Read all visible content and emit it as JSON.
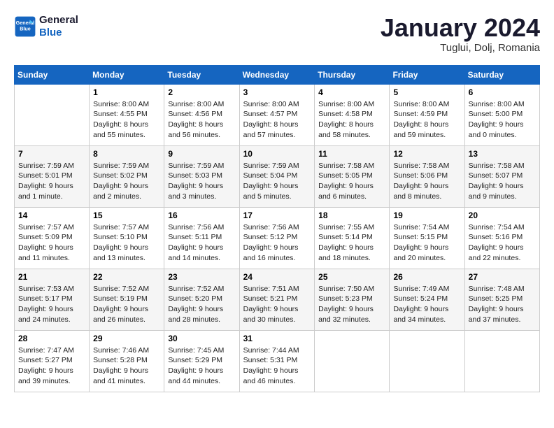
{
  "header": {
    "logo_line1": "General",
    "logo_line2": "Blue",
    "month": "January 2024",
    "location": "Tuglui, Dolj, Romania"
  },
  "weekdays": [
    "Sunday",
    "Monday",
    "Tuesday",
    "Wednesday",
    "Thursday",
    "Friday",
    "Saturday"
  ],
  "weeks": [
    [
      {
        "day": "",
        "info": ""
      },
      {
        "day": "1",
        "info": "Sunrise: 8:00 AM\nSunset: 4:55 PM\nDaylight: 8 hours\nand 55 minutes."
      },
      {
        "day": "2",
        "info": "Sunrise: 8:00 AM\nSunset: 4:56 PM\nDaylight: 8 hours\nand 56 minutes."
      },
      {
        "day": "3",
        "info": "Sunrise: 8:00 AM\nSunset: 4:57 PM\nDaylight: 8 hours\nand 57 minutes."
      },
      {
        "day": "4",
        "info": "Sunrise: 8:00 AM\nSunset: 4:58 PM\nDaylight: 8 hours\nand 58 minutes."
      },
      {
        "day": "5",
        "info": "Sunrise: 8:00 AM\nSunset: 4:59 PM\nDaylight: 8 hours\nand 59 minutes."
      },
      {
        "day": "6",
        "info": "Sunrise: 8:00 AM\nSunset: 5:00 PM\nDaylight: 9 hours\nand 0 minutes."
      }
    ],
    [
      {
        "day": "7",
        "info": "Sunrise: 7:59 AM\nSunset: 5:01 PM\nDaylight: 9 hours\nand 1 minute."
      },
      {
        "day": "8",
        "info": "Sunrise: 7:59 AM\nSunset: 5:02 PM\nDaylight: 9 hours\nand 2 minutes."
      },
      {
        "day": "9",
        "info": "Sunrise: 7:59 AM\nSunset: 5:03 PM\nDaylight: 9 hours\nand 3 minutes."
      },
      {
        "day": "10",
        "info": "Sunrise: 7:59 AM\nSunset: 5:04 PM\nDaylight: 9 hours\nand 5 minutes."
      },
      {
        "day": "11",
        "info": "Sunrise: 7:58 AM\nSunset: 5:05 PM\nDaylight: 9 hours\nand 6 minutes."
      },
      {
        "day": "12",
        "info": "Sunrise: 7:58 AM\nSunset: 5:06 PM\nDaylight: 9 hours\nand 8 minutes."
      },
      {
        "day": "13",
        "info": "Sunrise: 7:58 AM\nSunset: 5:07 PM\nDaylight: 9 hours\nand 9 minutes."
      }
    ],
    [
      {
        "day": "14",
        "info": "Sunrise: 7:57 AM\nSunset: 5:09 PM\nDaylight: 9 hours\nand 11 minutes."
      },
      {
        "day": "15",
        "info": "Sunrise: 7:57 AM\nSunset: 5:10 PM\nDaylight: 9 hours\nand 13 minutes."
      },
      {
        "day": "16",
        "info": "Sunrise: 7:56 AM\nSunset: 5:11 PM\nDaylight: 9 hours\nand 14 minutes."
      },
      {
        "day": "17",
        "info": "Sunrise: 7:56 AM\nSunset: 5:12 PM\nDaylight: 9 hours\nand 16 minutes."
      },
      {
        "day": "18",
        "info": "Sunrise: 7:55 AM\nSunset: 5:14 PM\nDaylight: 9 hours\nand 18 minutes."
      },
      {
        "day": "19",
        "info": "Sunrise: 7:54 AM\nSunset: 5:15 PM\nDaylight: 9 hours\nand 20 minutes."
      },
      {
        "day": "20",
        "info": "Sunrise: 7:54 AM\nSunset: 5:16 PM\nDaylight: 9 hours\nand 22 minutes."
      }
    ],
    [
      {
        "day": "21",
        "info": "Sunrise: 7:53 AM\nSunset: 5:17 PM\nDaylight: 9 hours\nand 24 minutes."
      },
      {
        "day": "22",
        "info": "Sunrise: 7:52 AM\nSunset: 5:19 PM\nDaylight: 9 hours\nand 26 minutes."
      },
      {
        "day": "23",
        "info": "Sunrise: 7:52 AM\nSunset: 5:20 PM\nDaylight: 9 hours\nand 28 minutes."
      },
      {
        "day": "24",
        "info": "Sunrise: 7:51 AM\nSunset: 5:21 PM\nDaylight: 9 hours\nand 30 minutes."
      },
      {
        "day": "25",
        "info": "Sunrise: 7:50 AM\nSunset: 5:23 PM\nDaylight: 9 hours\nand 32 minutes."
      },
      {
        "day": "26",
        "info": "Sunrise: 7:49 AM\nSunset: 5:24 PM\nDaylight: 9 hours\nand 34 minutes."
      },
      {
        "day": "27",
        "info": "Sunrise: 7:48 AM\nSunset: 5:25 PM\nDaylight: 9 hours\nand 37 minutes."
      }
    ],
    [
      {
        "day": "28",
        "info": "Sunrise: 7:47 AM\nSunset: 5:27 PM\nDaylight: 9 hours\nand 39 minutes."
      },
      {
        "day": "29",
        "info": "Sunrise: 7:46 AM\nSunset: 5:28 PM\nDaylight: 9 hours\nand 41 minutes."
      },
      {
        "day": "30",
        "info": "Sunrise: 7:45 AM\nSunset: 5:29 PM\nDaylight: 9 hours\nand 44 minutes."
      },
      {
        "day": "31",
        "info": "Sunrise: 7:44 AM\nSunset: 5:31 PM\nDaylight: 9 hours\nand 46 minutes."
      },
      {
        "day": "",
        "info": ""
      },
      {
        "day": "",
        "info": ""
      },
      {
        "day": "",
        "info": ""
      }
    ]
  ]
}
